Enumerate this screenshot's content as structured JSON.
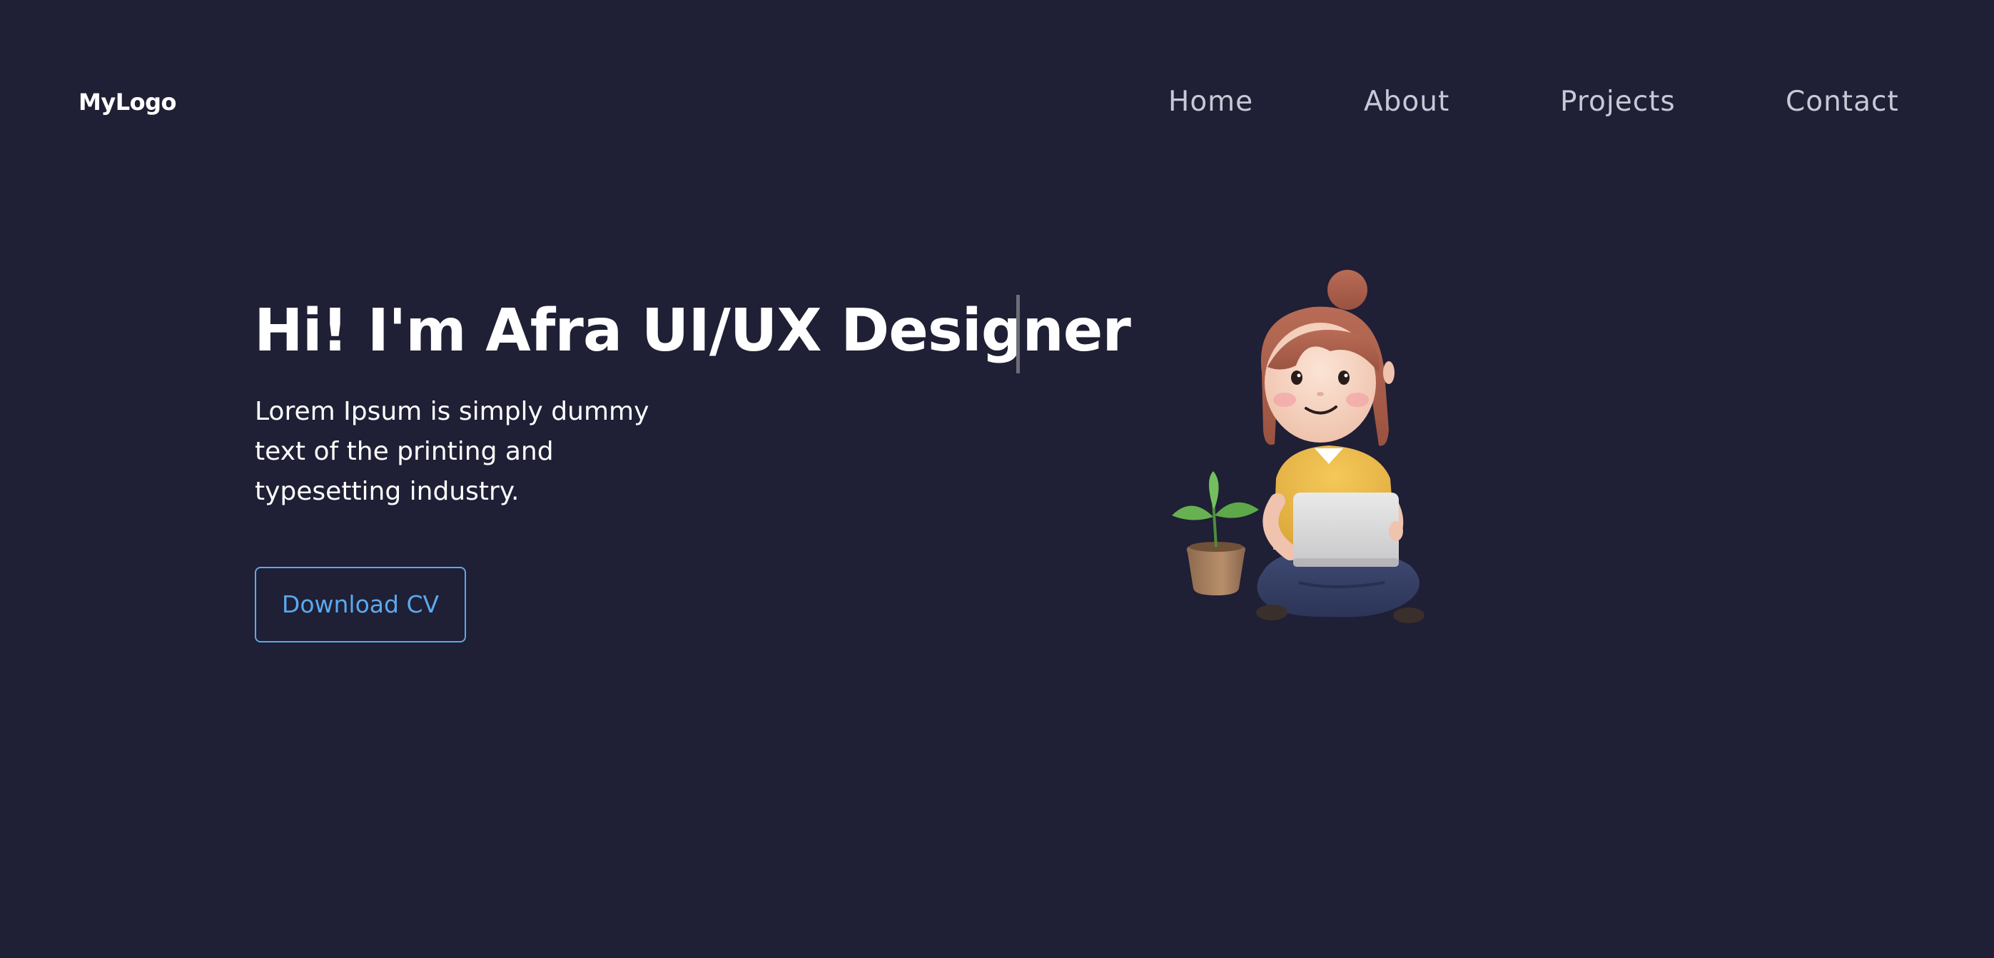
{
  "nav": {
    "logo": "MyLogo",
    "links": [
      "Home",
      "About",
      "Projects",
      "Contact"
    ]
  },
  "hero": {
    "title": "Hi! I'm Afra UI/UX Designer",
    "description": "Lorem Ipsum is simply dummy text of the printing and typesetting industry.",
    "cta_label": "Download CV"
  },
  "colors": {
    "background": "#1f1f35",
    "text": "#ffffff",
    "nav_text": "#c8c8d6",
    "accent": "#5aa9ee"
  }
}
